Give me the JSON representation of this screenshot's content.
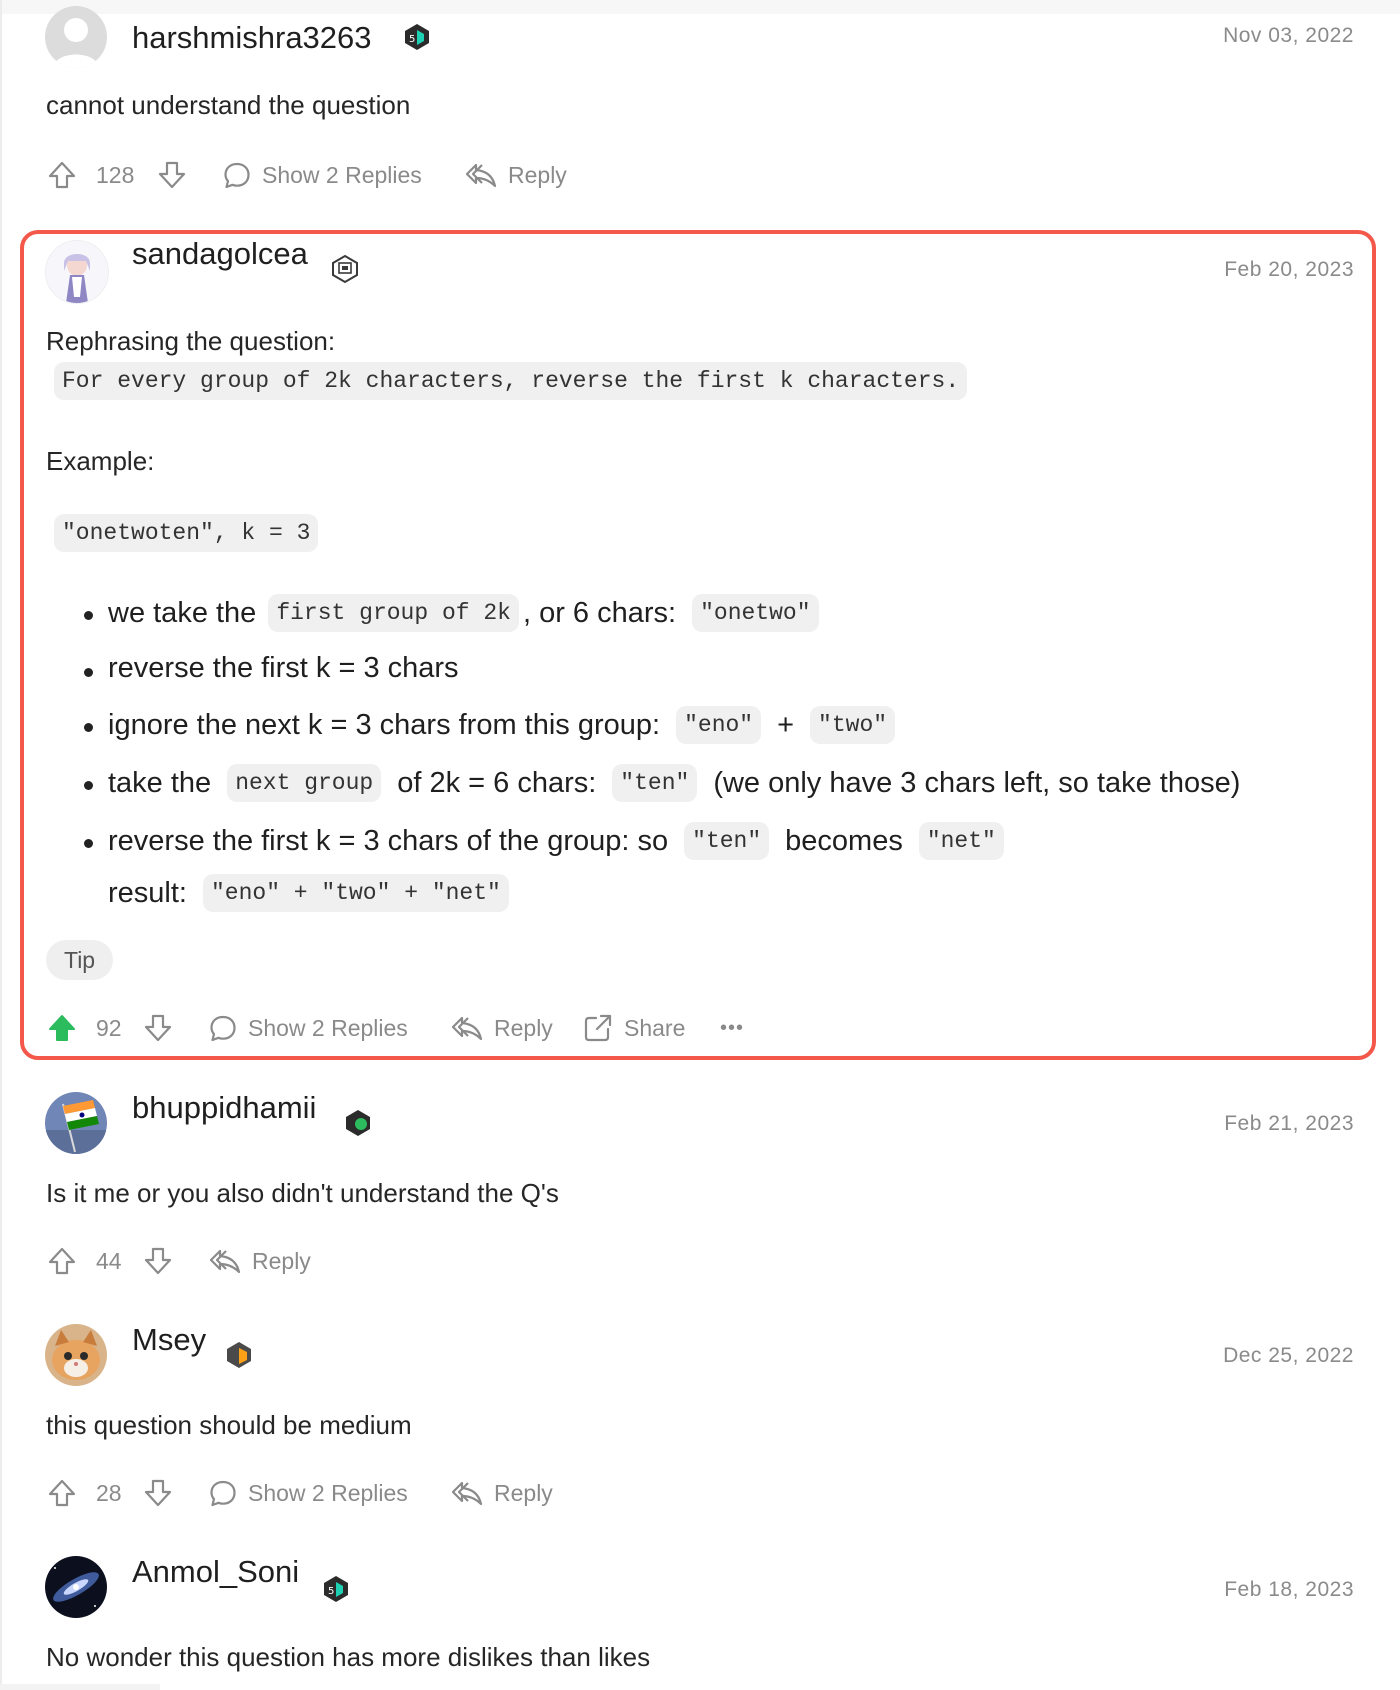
{
  "comments": [
    {
      "username": "harshmishra3263",
      "date": "Nov 03, 2022",
      "text": "cannot understand the question",
      "votes": "128",
      "show_replies": "Show 2 Replies",
      "reply": "Reply"
    },
    {
      "username": "sandagolcea",
      "date": "Feb 20, 2023",
      "intro": "Rephrasing the question:",
      "rephrase_code": "For every group of 2k characters, reverse the first k characters.",
      "example_label": "Example:",
      "example_code": "\"onetwoten\", k = 3",
      "bullets": {
        "b1_a": "we take the",
        "b1_code": "first group of 2k",
        "b1_b": ", or 6 chars:",
        "b1_code2": "\"onetwo\"",
        "b2": "reverse the first k = 3 chars",
        "b3_a": "ignore the next k = 3 chars from this group:",
        "b3_code1": "\"eno\"",
        "b3_plus": "+",
        "b3_code2": "\"two\"",
        "b4_a": "take the",
        "b4_code": "next group",
        "b4_b": "of 2k = 6 chars:",
        "b4_code2": "\"ten\"",
        "b4_c": "(we only have 3 chars left, so take those)",
        "b5_a": "reverse the first k = 3 chars of the group: so",
        "b5_code1": "\"ten\"",
        "b5_b": "becomes",
        "b5_code2": "\"net\"",
        "result_label": "result:",
        "result_code": "\"eno\" + \"two\" + \"net\""
      },
      "tag": "Tip",
      "votes": "92",
      "show_replies": "Show 2 Replies",
      "reply": "Reply",
      "share": "Share",
      "more": "•••",
      "upvoted_color": "#2cbb5d",
      "highlight_color": "#f4584a"
    },
    {
      "username": "bhuppidhamii",
      "date": "Feb 21, 2023",
      "text": "Is it me or you also didn't understand the Q's",
      "votes": "44",
      "reply": "Reply"
    },
    {
      "username": "Msey",
      "date": "Dec 25, 2022",
      "text": "this question should be medium",
      "votes": "28",
      "show_replies": "Show 2 Replies",
      "reply": "Reply"
    },
    {
      "username": "Anmol_Soni",
      "date": "Feb 18, 2023",
      "text": "No wonder this question has more dislikes than likes"
    }
  ]
}
